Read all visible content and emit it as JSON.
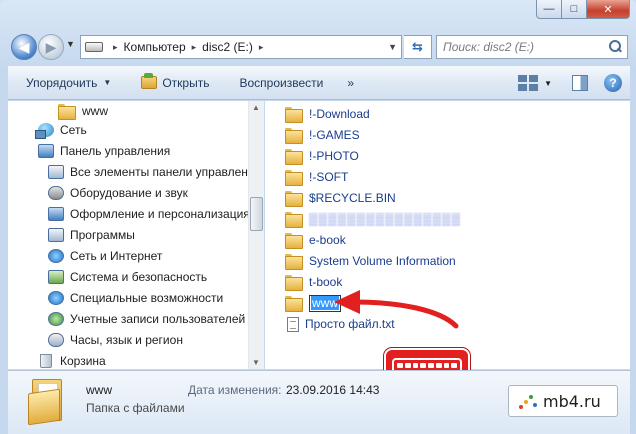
{
  "window": {
    "minimize_glyph": "—",
    "maximize_glyph": "□",
    "close_glyph": "✕"
  },
  "address": {
    "crumbs": [
      "Компьютер",
      "disc2 (E:)"
    ],
    "separator": "▸",
    "search_placeholder": "Поиск: disc2 (E:)"
  },
  "toolbar": {
    "organize": "Упорядочить",
    "open": "Открыть",
    "play": "Воспроизвести",
    "more": "»"
  },
  "nav_tree": [
    {
      "label": "www",
      "icon": "folder-icon"
    },
    {
      "label": "Сеть",
      "icon": "network-icon"
    },
    {
      "label": "Панель управления",
      "icon": "control-panel-icon"
    },
    {
      "label": "Все элементы панели управления",
      "icon": "all-items-icon"
    },
    {
      "label": "Оборудование и звук",
      "icon": "hardware-icon"
    },
    {
      "label": "Оформление и персонализация",
      "icon": "appearance-icon"
    },
    {
      "label": "Программы",
      "icon": "programs-icon"
    },
    {
      "label": "Сеть и Интернет",
      "icon": "network-internet-icon"
    },
    {
      "label": "Система и безопасность",
      "icon": "system-security-icon"
    },
    {
      "label": "Специальные возможности",
      "icon": "accessibility-icon"
    },
    {
      "label": "Учетные записи пользователей",
      "icon": "user-accounts-icon"
    },
    {
      "label": "Часы, язык и регион",
      "icon": "clock-region-icon"
    },
    {
      "label": "Корзина",
      "icon": "recycle-bin-icon"
    }
  ],
  "files": [
    {
      "label": "!-Download",
      "type": "folder"
    },
    {
      "label": "!-GAMES",
      "type": "folder"
    },
    {
      "label": "!-PHOTO",
      "type": "folder"
    },
    {
      "label": "!-SOFT",
      "type": "folder"
    },
    {
      "label": "$RECYCLE.BIN",
      "type": "folder"
    },
    {
      "label": "",
      "type": "folder-obscured"
    },
    {
      "label": "e-book",
      "type": "folder"
    },
    {
      "label": "System Volume Information",
      "type": "folder"
    },
    {
      "label": "t-book",
      "type": "folder"
    },
    {
      "label": "www",
      "type": "folder-renaming"
    },
    {
      "label": "Просто файл.txt",
      "type": "text-file"
    }
  ],
  "details": {
    "name": "www",
    "type": "Папка с файлами",
    "date_label": "Дата изменения:",
    "date_value": "23.09.2016 14:43"
  },
  "watermark": {
    "text": "mb4.ru"
  },
  "colors": {
    "annotation_red": "#e32020",
    "selection_blue": "#3399ff",
    "link_blue": "#1a3e8c"
  }
}
